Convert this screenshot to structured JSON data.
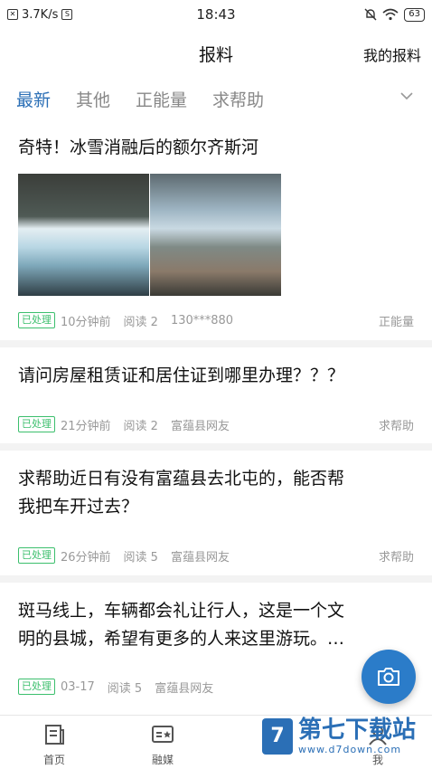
{
  "status": {
    "speed": "3.7K/s",
    "sim_icon": "S",
    "time": "18:43",
    "battery": "63"
  },
  "nav": {
    "title": "报料",
    "my_reports": "我的报料"
  },
  "tabs": [
    {
      "label": "最新",
      "active": true
    },
    {
      "label": "其他",
      "active": false
    },
    {
      "label": "正能量",
      "active": false
    },
    {
      "label": "求帮助",
      "active": false
    }
  ],
  "feed": [
    {
      "title": "奇特！冰雪消融后的额尔齐斯河",
      "status": "已处理",
      "time": "10分钟前",
      "reads": "阅读 2",
      "author": "130***880",
      "category": "正能量"
    },
    {
      "title": "请问房屋租赁证和居住证到哪里办理？？？",
      "status": "已处理",
      "time": "21分钟前",
      "reads": "阅读 2",
      "author": "富蕴县网友",
      "category": "求帮助"
    },
    {
      "title_line1": "求帮助近日有没有富蕴县去北屯的，能否帮",
      "title_line2": "我把车开过去？",
      "status": "已处理",
      "time": "26分钟前",
      "reads": "阅读 5",
      "author": "富蕴县网友",
      "category": "求帮助"
    },
    {
      "title_line1": "斑马线上，车辆都会礼让行人，这是一个文",
      "title_line2": "明的县城，希望有更多的人来这里游玩。…",
      "status": "已处理",
      "time": "03-17",
      "reads": "阅读 5",
      "author": "富蕴县网友"
    }
  ],
  "bottom_nav": [
    {
      "label": "首页",
      "icon": "document-icon"
    },
    {
      "label": "融媒",
      "icon": "media-icon"
    },
    {
      "label": "我",
      "icon": "user-icon"
    }
  ],
  "watermark": {
    "logo": "7",
    "name": "第七下载站",
    "url": "www.d7down.com"
  },
  "colors": {
    "accent": "#2b6fb6",
    "badge": "#3cbf6d",
    "fab": "#2b7cc9"
  }
}
